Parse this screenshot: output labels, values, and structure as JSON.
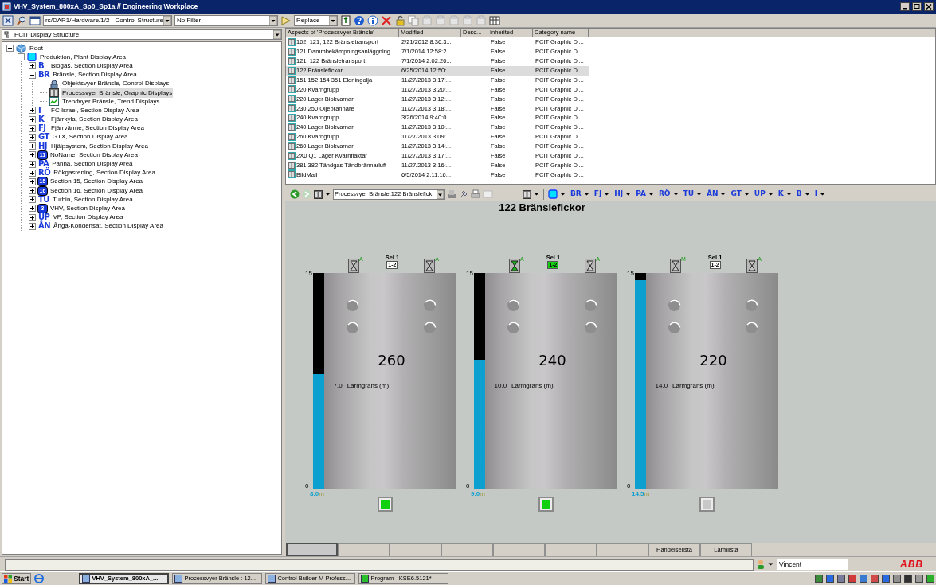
{
  "window": {
    "title": "VHV_System_800xA_Sp0_Sp1a // Engineering Workplace"
  },
  "toolbar": {
    "path": "rs/DAR1/Hardware/1/2 - Control Structure",
    "filter": "No Filter",
    "mode": "Replace"
  },
  "structure_selector": "PCIT Display Structure",
  "tree": [
    {
      "label": "Root",
      "kind": "cube",
      "expanded": true,
      "selected": false,
      "children": [
        {
          "label": "Produktion, Plant Display Area",
          "kind": "square",
          "expanded": true,
          "selected": false,
          "children": [
            {
              "label": "Biogas, Section Display Area",
              "kind": "letters",
              "badge": "B",
              "expanded": false,
              "selected": false
            },
            {
              "label": "Bränsle, Section Display Area",
              "kind": "letters",
              "badge": "BR",
              "expanded": true,
              "selected": false,
              "children": [
                {
                  "label": "Objektsvyer Bränsle, Control Displays",
                  "kind": "object",
                  "selected": false
                },
                {
                  "label": "Processvyer Bränsle, Graphic Displays",
                  "kind": "graphic",
                  "selected": true
                },
                {
                  "label": "Trendvyer Bränsle, Trend Displays",
                  "kind": "trend",
                  "selected": false
                }
              ]
            },
            {
              "label": "FC Israel, Section Display Area",
              "kind": "letters",
              "badge": "I",
              "expanded": false,
              "selected": false
            },
            {
              "label": "Fjärrkyla, Section Display Area",
              "kind": "letters",
              "badge": "K",
              "expanded": false,
              "selected": false
            },
            {
              "label": "Fjärrvärme, Section Display Area",
              "kind": "letters",
              "badge": "FJ",
              "expanded": false,
              "selected": false
            },
            {
              "label": "GTX, Section Display Area",
              "kind": "letters",
              "badge": "GT",
              "expanded": false,
              "selected": false
            },
            {
              "label": "Hjälpsystem, Section Display Area",
              "kind": "letters",
              "badge": "HJ",
              "expanded": false,
              "selected": false
            },
            {
              "label": "NoName, Section Display Area",
              "kind": "number",
              "badge": "11",
              "expanded": false,
              "selected": false
            },
            {
              "label": "Panna, Section Display Area",
              "kind": "letters",
              "badge": "PA",
              "expanded": false,
              "selected": false
            },
            {
              "label": "Rökgasrening, Section Display Area",
              "kind": "letters",
              "badge": "RÖ",
              "expanded": false,
              "selected": false
            },
            {
              "label": "Section 15, Section Display Area",
              "kind": "number",
              "badge": "15",
              "expanded": false,
              "selected": false
            },
            {
              "label": "Section 16, Section Display Area",
              "kind": "number",
              "badge": "16",
              "expanded": false,
              "selected": false
            },
            {
              "label": "Turbin, Section Display Area",
              "kind": "letters",
              "badge": "TU",
              "expanded": false,
              "selected": false
            },
            {
              "label": "VHV, Section Display Area",
              "kind": "number",
              "badge": "3",
              "expanded": false,
              "selected": false
            },
            {
              "label": "VP, Section Display Area",
              "kind": "letters",
              "badge": "UP",
              "expanded": false,
              "selected": false
            },
            {
              "label": "Ånga-Kondensat, Section Display Area",
              "kind": "letters",
              "badge": "ÅN",
              "expanded": false,
              "selected": false
            }
          ]
        }
      ]
    }
  ],
  "aspects": {
    "columns": [
      "Aspects of 'Processvyer Bränsle'",
      "Modified",
      "Desc...",
      "Inherited",
      "Category name"
    ],
    "rows": [
      {
        "name": "102, 121, 122 Bränsletransport",
        "modified": "2/21/2012 8:36:3...",
        "inherited": "False",
        "category": "PCIT Graphic Di...",
        "selected": false
      },
      {
        "name": "121 Dammbekämpningsanläggning",
        "modified": "7/1/2014 12:58:2...",
        "inherited": "False",
        "category": "PCIT Graphic Di...",
        "selected": false
      },
      {
        "name": "121, 122 Bränsletransport",
        "modified": "7/1/2014 2:02:20...",
        "inherited": "False",
        "category": "PCIT Graphic Di...",
        "selected": false
      },
      {
        "name": "122 Bränslefickor",
        "modified": "6/25/2014 12:50:...",
        "inherited": "False",
        "category": "PCIT Graphic Di...",
        "selected": true
      },
      {
        "name": "151 152 154 351 Eldningolja",
        "modified": "11/27/2013 3:17:...",
        "inherited": "False",
        "category": "PCIT Graphic Di...",
        "selected": false
      },
      {
        "name": "220 Kvarngrupp",
        "modified": "11/27/2013 3:20:...",
        "inherited": "False",
        "category": "PCIT Graphic Di...",
        "selected": false
      },
      {
        "name": "220 Lager Biokvarnar",
        "modified": "11/27/2013 3:12:...",
        "inherited": "False",
        "category": "PCIT Graphic Di...",
        "selected": false
      },
      {
        "name": "230 250 Oljebrännare",
        "modified": "11/27/2013 3:18:...",
        "inherited": "False",
        "category": "PCIT Graphic Di...",
        "selected": false
      },
      {
        "name": "240 Kvarngrupp",
        "modified": "3/26/2014 9:40:0...",
        "inherited": "False",
        "category": "PCIT Graphic Di...",
        "selected": false
      },
      {
        "name": "240 Lager Biokvarnar",
        "modified": "11/27/2013 3:10:...",
        "inherited": "False",
        "category": "PCIT Graphic Di...",
        "selected": false
      },
      {
        "name": "260 Kvarngrupp",
        "modified": "11/27/2013 3:09:...",
        "inherited": "False",
        "category": "PCIT Graphic Di...",
        "selected": false
      },
      {
        "name": "260 Lager Biokvarnar",
        "modified": "11/27/2013 3:14:...",
        "inherited": "False",
        "category": "PCIT Graphic Di...",
        "selected": false
      },
      {
        "name": "2X0 Q1 Lager Kvarnfläktar",
        "modified": "11/27/2013 3:17:...",
        "inherited": "False",
        "category": "PCIT Graphic Di...",
        "selected": false
      },
      {
        "name": "381 382 Tändgas Tändbrännarluft",
        "modified": "11/27/2013 3:16:...",
        "inherited": "False",
        "category": "PCIT Graphic Di...",
        "selected": false
      },
      {
        "name": "BildMall",
        "modified": "6/5/2014 2:11:16...",
        "inherited": "False",
        "category": "PCIT Graphic Di...",
        "selected": false
      }
    ]
  },
  "display_toolbar": {
    "display": "Processvyer Bränsle:122 Bränslefick",
    "nav": [
      "BR",
      "FJ",
      "HJ",
      "PA",
      "RÖ",
      "TU",
      "ÅN",
      "GT",
      "UP",
      "K",
      "B",
      "I"
    ]
  },
  "display": {
    "title": "122 Bränslefickor",
    "silos": [
      {
        "name": "260",
        "scale_max": "15",
        "scale_min": "0",
        "level": 0.533,
        "reading": "8.0",
        "unit": "m",
        "alarm": "7.0",
        "alarm_label": "Larmgräns (m)",
        "sel_label": "Sel 1",
        "sel_value": "1-2",
        "sel_active": false,
        "indicator_on": true,
        "valves": [
          {
            "mode": "A",
            "active": false
          },
          {
            "mode": "A",
            "active": false
          }
        ]
      },
      {
        "name": "240",
        "scale_max": "15",
        "scale_min": "0",
        "level": 0.6,
        "reading": "9.0",
        "unit": "m",
        "alarm": "10.0",
        "alarm_label": "Larmgräns (m)",
        "sel_label": "Sel 1",
        "sel_value": "1-2",
        "sel_active": true,
        "indicator_on": true,
        "valves": [
          {
            "mode": "A",
            "active": true
          },
          {
            "mode": "A",
            "active": false
          }
        ]
      },
      {
        "name": "220",
        "scale_max": "15",
        "scale_min": "0",
        "level": 0.967,
        "reading": "14.5",
        "unit": "m",
        "alarm": "14.0",
        "alarm_label": "Larmgräns (m)",
        "sel_label": "Sel 1",
        "sel_value": "1-2",
        "sel_active": false,
        "indicator_on": false,
        "valves": [
          {
            "mode": "M",
            "active": false
          },
          {
            "mode": "A",
            "active": false
          }
        ]
      }
    ]
  },
  "display_slots": [
    {
      "selected": true
    },
    {
      "selected": false
    },
    {
      "selected": false
    },
    {
      "selected": false
    },
    {
      "selected": false
    },
    {
      "selected": false
    },
    {
      "selected": false
    }
  ],
  "list_buttons": [
    "Händelselista",
    "Larmlista"
  ],
  "status_bar": {
    "user": "Vincent",
    "logo": "ABB"
  },
  "taskbar": {
    "start": "Start",
    "tasks": [
      {
        "label": "VHV_System_800xA_...",
        "selected": true
      },
      {
        "label": "Processvyer Bränsle : 12...",
        "selected": false
      },
      {
        "label": "Control Builder M Profess...",
        "selected": false
      },
      {
        "label": "Program - KSE6.5121*",
        "selected": false
      }
    ]
  }
}
